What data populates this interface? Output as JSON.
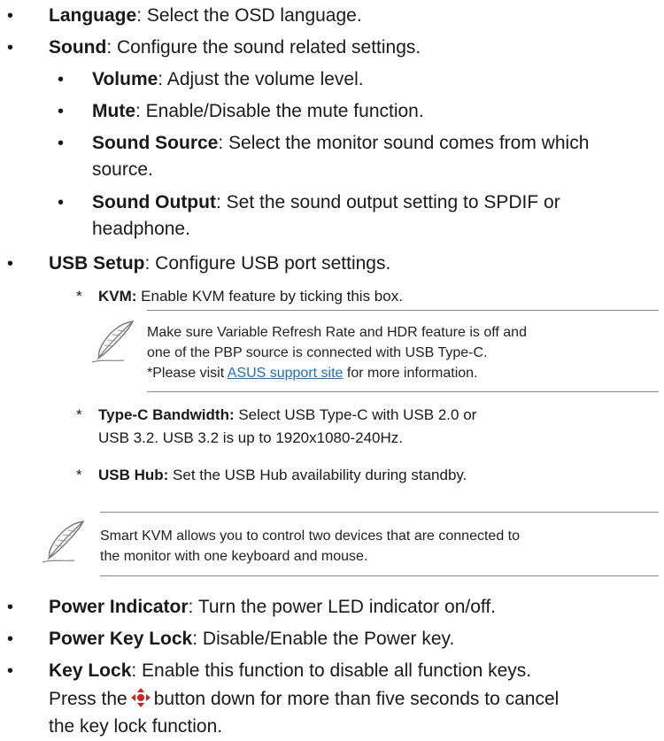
{
  "items": [
    {
      "term": "Language",
      "desc": ": Select the OSD language."
    },
    {
      "term": "Sound",
      "desc": ": Configure the sound related settings."
    },
    {
      "term": "Volume",
      "desc": ": Adjust the volume level."
    },
    {
      "term": "Mute",
      "desc": ": Enable/Disable the mute function."
    },
    {
      "term": "Sound Source",
      "desc_line1": ": Select the monitor sound comes from which",
      "desc_line2": "source."
    },
    {
      "term": "Sound Output",
      "desc_line1": ": Set the sound output setting to SPDIF or",
      "desc_line2": "headphone."
    },
    {
      "term": "USB Setup",
      "desc": ": Configure USB port settings."
    },
    {
      "term": "KVM:",
      "desc": " Enable KVM feature by ticking this box."
    },
    {
      "term": "Type-C Bandwidth:",
      "desc_line1": " Select USB Type-C with USB 2.0 or",
      "desc_line2": "USB 3.2. USB 3.2 is up to 1920x1080-240Hz."
    },
    {
      "term": "USB Hub:",
      "desc": " Set the USB Hub availability during standby."
    },
    {
      "term": "Power Indicator",
      "desc": ": Turn the power LED indicator on/off."
    },
    {
      "term": "Power Key Lock",
      "desc": ": Disable/Enable the Power key."
    },
    {
      "term": "Key Lock",
      "desc_line1": ": Enable this function to disable all function keys.",
      "desc_line2_pre": "Press the",
      "desc_line2_post": "button down for more than five seconds to cancel",
      "desc_line3": "the key lock function."
    }
  ],
  "note1": {
    "line1": "Make sure Variable Refresh Rate and HDR feature is off and",
    "line2": "one of the PBP source is connected with USB Type-C.",
    "line3_pre": "*Please visit ",
    "link": "ASUS support site",
    "line3_post": " for more information."
  },
  "note2": {
    "line1": "Smart KVM allows you to control two devices that are connected to",
    "line2": "the monitor with one keyboard and mouse."
  },
  "bullet_char": "•",
  "star_char": "*",
  "icons": {
    "note": "feather-quill-icon",
    "button": "five-way-navigation-key-icon"
  },
  "colors": {
    "text": "#1a1a1a",
    "link": "#1a6fc4",
    "dpad": "#d42020"
  }
}
